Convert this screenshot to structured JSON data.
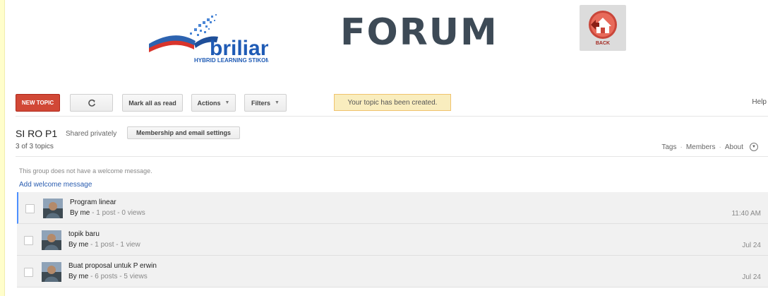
{
  "header": {
    "logo_word": "brilian",
    "logo_tagline": "HYBRID LEARNING STIKOM SURABAYA",
    "title": "FORUM",
    "back_label": "BACK"
  },
  "toolbar": {
    "new_topic": "NEW TOPIC",
    "refresh_icon": "refresh-icon",
    "mark_all_read": "Mark all as read",
    "actions": "Actions",
    "filters": "Filters",
    "notice": "Your topic has been created.",
    "help": "Help"
  },
  "group": {
    "name": "SI RO P1",
    "shared": "Shared privately",
    "membership_button": "Membership and email settings",
    "topic_count": "3 of 3 topics",
    "links": [
      "Tags",
      "Members",
      "About"
    ]
  },
  "welcome": {
    "message": "This group does not have a welcome message.",
    "add_link": "Add welcome message"
  },
  "topics": [
    {
      "title": "Program linear",
      "author": "By me",
      "meta": " - 1 post - 0 views",
      "date": "11:40 AM"
    },
    {
      "title": "topik baru",
      "author": "By me",
      "meta": " - 1 post - 1 view",
      "date": "Jul 24"
    },
    {
      "title": "Buat proposal untuk P erwin",
      "author": "By me",
      "meta": " - 6 posts - 5 views",
      "date": "Jul 24"
    }
  ],
  "colors": {
    "page_bg": "#fffecb",
    "new_topic_red": "#d14836",
    "notice_bg": "#f9edbe",
    "link_blue": "#2a5db0",
    "forum_title": "#3d4a56"
  }
}
